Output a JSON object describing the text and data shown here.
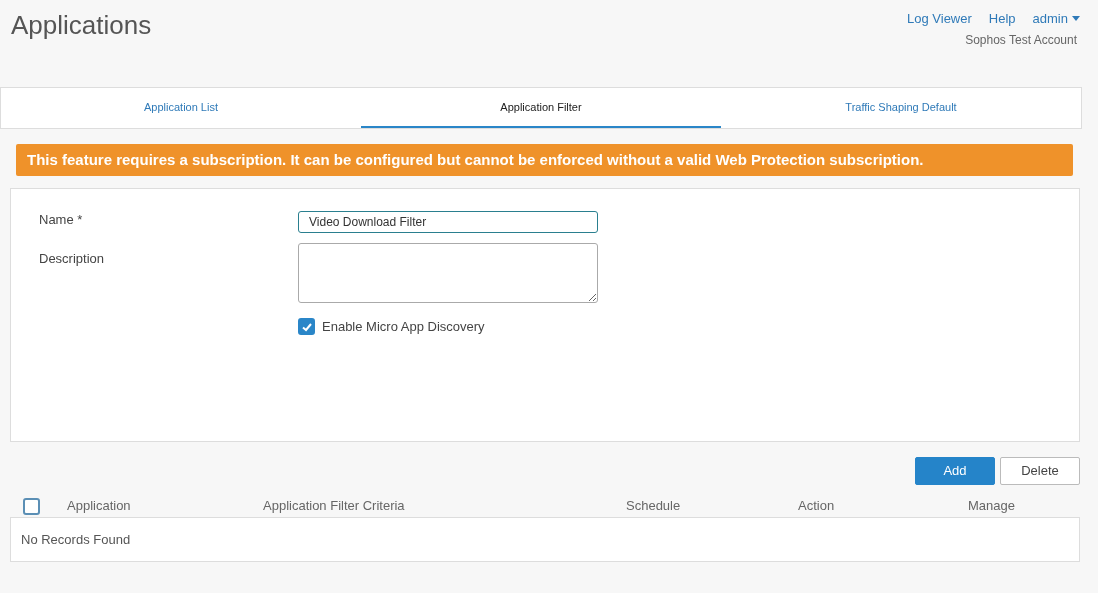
{
  "page_title": "Applications",
  "header_links": [
    "Log Viewer",
    "Help"
  ],
  "user_menu": {
    "label": "admin",
    "account": "Sophos Test Account"
  },
  "tabs": [
    {
      "label": "Application List",
      "selected": false
    },
    {
      "label": "Application Filter",
      "selected": true
    },
    {
      "label": "Traffic Shaping Default",
      "selected": false
    }
  ],
  "banner": "This feature requires a subscription. It can be configured but cannot be enforced without a valid Web Protection subscription.",
  "form": {
    "name_label": "Name *",
    "name_value": "Video Download Filter",
    "description_label": "Description",
    "micro_app": {
      "label": "Enable Micro App Discovery",
      "checked": true
    }
  },
  "buttons": [
    {
      "label": "Add",
      "kind": "primary"
    },
    {
      "label": "Delete",
      "kind": "secondary"
    }
  ],
  "table": {
    "select_all": {
      "checked": false
    },
    "columns": [
      "Application",
      "Application Filter Criteria",
      "Schedule",
      "Action",
      "Manage"
    ],
    "empty_text": "No Records Found"
  }
}
